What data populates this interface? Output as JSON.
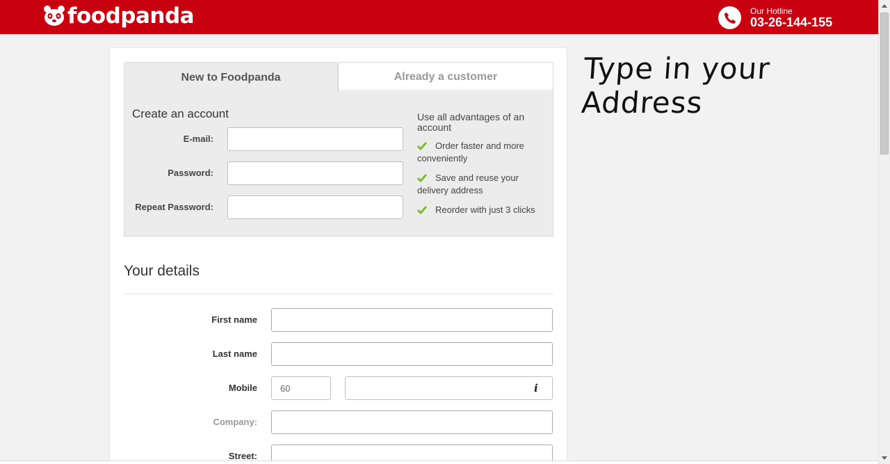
{
  "header": {
    "brand": "foodpanda",
    "hotline_label": "Our Hotline",
    "hotline_number": "03-26-144-155",
    "bg_color": "#c8000f"
  },
  "tabs": [
    {
      "label": "New to Foodpanda",
      "active": true
    },
    {
      "label": "Already a customer",
      "active": false
    }
  ],
  "account": {
    "title": "Create an account",
    "fields": [
      {
        "label": "E-mail:",
        "value": ""
      },
      {
        "label": "Password:",
        "value": ""
      },
      {
        "label": "Repeat Password:",
        "value": ""
      }
    ],
    "advantages_heading": "Use all advantages of an account",
    "advantages": [
      "Order faster and more conveniently",
      "Save and reuse your delivery address",
      "Reorder with just 3 clicks"
    ]
  },
  "details": {
    "title": "Your details",
    "first_name_label": "First name",
    "last_name_label": "Last name",
    "mobile_label": "Mobile",
    "mobile_prefix": "60",
    "company_label": "Company:",
    "street_label": "Street:"
  },
  "annotation": "Type in your Address",
  "icons": {
    "phone": "phone-icon",
    "check": "check-icon",
    "info": "info-icon",
    "logo": "panda-logo-icon"
  }
}
